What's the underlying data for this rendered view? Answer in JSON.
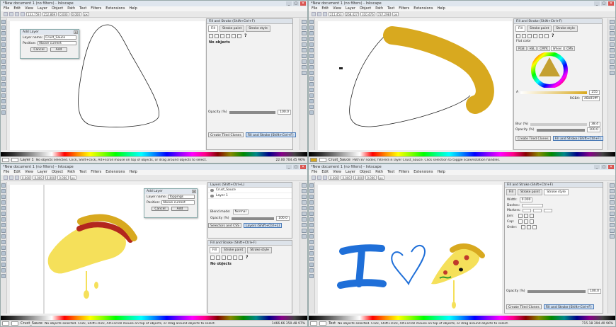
{
  "windows": [
    {
      "title": "*New document 1 (no filters) - Inkscape",
      "menus": [
        "File",
        "Edit",
        "View",
        "Layer",
        "Object",
        "Path",
        "Text",
        "Filters",
        "Extensions",
        "Help"
      ],
      "cmd_fields": [
        "133.759",
        "X",
        "252.869",
        "Y",
        "0.000",
        "W",
        "0.000",
        "px"
      ],
      "dialog": {
        "title": "Add Layer",
        "name_label": "Layer name:",
        "name_value": "Crust_Sauce",
        "pos_label": "Position:",
        "pos_value": "Above current",
        "cancel": "Cancel",
        "add": "Add"
      },
      "dock": {
        "header": "Fill and Stroke (Shift+Ctrl+F)",
        "tab_fill": "Fill",
        "tab_stroke_paint": "Stroke paint",
        "tab_stroke_style": "Stroke style",
        "no_objects": "No objects",
        "opacity_label": "Opacity (%)",
        "opacity_value": "100.0",
        "bottom_tabs": [
          "Create Tiled Clones",
          "Fill and Stroke (Shift+Ctrl+F)"
        ]
      },
      "status": {
        "layer": "Layer 1",
        "message": "No objects selected. Click, Shift+click, Alt+scroll mouse on top of objects, or drag around objects to select.",
        "x": "22.00",
        "y": "704.45",
        "zoom": "96%"
      }
    },
    {
      "title": "*New document 1 (no filters) - Inkscape",
      "menus": [
        "File",
        "Edit",
        "View",
        "Layer",
        "Object",
        "Path",
        "Text",
        "Filters",
        "Extensions",
        "Help"
      ],
      "cmd_fields": [
        "211.453",
        "X",
        "268.427",
        "Y",
        "310.476",
        "W",
        "737.298",
        "px"
      ],
      "dock": {
        "header": "Fill and Stroke (Shift+Ctrl+F)",
        "tab_fill": "Fill",
        "tab_stroke_paint": "Stroke paint",
        "tab_stroke_style": "Stroke style",
        "flat_color": "Flat color",
        "pickers": [
          "RGB",
          "HSL",
          "CMYK",
          "Wheel",
          "CMS"
        ],
        "alpha_label": "A",
        "alpha_value": "255",
        "rgba_label": "RGBA:",
        "rgba_value": "d8a91fff",
        "blur_label": "Blur (%)",
        "blur_value": "38.4",
        "opacity_label": "Opacity (%)",
        "opacity_value": "100.0",
        "bottom_tabs": [
          "Create Tiled Clones",
          "Fill and Stroke (Shift+Ctrl+F)"
        ]
      },
      "status": {
        "layer": "Crust_Sauce",
        "message": "Path 87 nodes; filtered in layer Crust_Sauce. Click selection to toggle scale/rotation handles.",
        "x": "",
        "y": "",
        "zoom": ""
      }
    },
    {
      "title": "*New document 1 (no filters) - Inkscape",
      "menus": [
        "File",
        "Edit",
        "View",
        "Layer",
        "Object",
        "Path",
        "Text",
        "Filters",
        "Extensions",
        "Help"
      ],
      "cmd_fields": [
        "0.000",
        "X",
        "0.000",
        "Y",
        "0.000",
        "W",
        "0.000",
        "px"
      ],
      "dialog": {
        "title": "Add Layer",
        "name_label": "Layer name:",
        "name_value": "Toppings",
        "pos_label": "Position:",
        "pos_value": "Above current",
        "cancel": "Cancel",
        "add": "Add"
      },
      "layers_dock": {
        "header": "Layers (Shift+Ctrl+L)",
        "layers": [
          "Crust_Sauce",
          "Layer 1"
        ],
        "blend_label": "Blend mode:",
        "blend_value": "Normal",
        "opacity_label": "Opacity (%)",
        "opacity_value": "100.0",
        "tabs": [
          "Selectors and CSS",
          "Layers (Shift+Ctrl+L)"
        ]
      },
      "dock": {
        "header": "Fill and Stroke (Shift+Ctrl+F)",
        "tab_fill": "Fill",
        "tab_stroke_paint": "Stroke paint",
        "tab_stroke_style": "Stroke style",
        "no_objects": "No objects",
        "opacity_label": "Opacity (%)",
        "opacity_value": "100.0"
      },
      "status": {
        "layer": "Crust_Sauce",
        "message": "No objects selected. Click, Shift+click, Alt+scroll mouse on top of objects, or drag around objects to select.",
        "x": "1466.66",
        "y": "350.48",
        "zoom": "97%"
      }
    },
    {
      "title": "*New document 1 (no filters) - Inkscape",
      "menus": [
        "File",
        "Edit",
        "View",
        "Layer",
        "Object",
        "Path",
        "Text",
        "Filters",
        "Extensions",
        "Help"
      ],
      "cmd_fields": [
        "0.000",
        "X",
        "0.000",
        "Y",
        "0.000",
        "W",
        "0.000",
        "px"
      ],
      "dock": {
        "header": "Fill and Stroke (Shift+Ctrl+F)",
        "tab_fill": "Fill",
        "tab_stroke_paint": "Stroke paint",
        "tab_stroke_style": "Stroke style",
        "width_label": "Width:",
        "width_value": "0.000",
        "dashes_label": "Dashes:",
        "markers_label": "Markers:",
        "join_label": "Join:",
        "cap_label": "Cap:",
        "order_label": "Order:",
        "opacity_label": "Opacity (%)",
        "opacity_value": "100.0",
        "bottom_tabs": [
          "Create Tiled Clones",
          "Fill and Stroke (Shift+Ctrl+F)"
        ]
      },
      "status": {
        "layer": "Text",
        "message": "No objects selected. Click, Shift+click, Alt+scroll mouse on top of objects, or drag around objects to select.",
        "x": "715.18",
        "y": "394.40",
        "zoom": "96%"
      }
    }
  ],
  "colors": {
    "crust": "#d8a91f",
    "cheese": "#f5e05a",
    "sauce": "#b3261e",
    "blue": "#1f6fd8",
    "pepperoni": "#c0392b"
  }
}
